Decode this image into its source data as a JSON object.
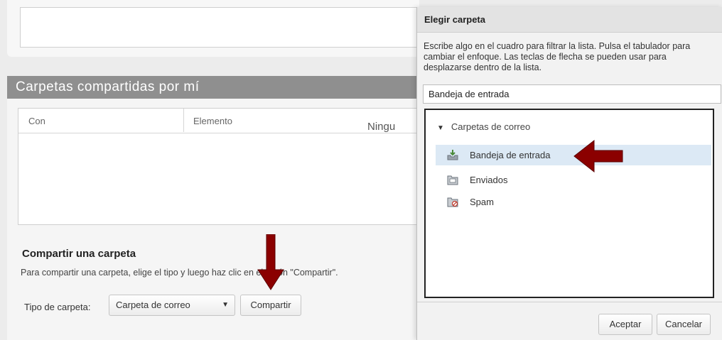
{
  "top_field": {
    "value": ""
  },
  "shared_by_me": {
    "header": "Carpetas compartidas por mí",
    "columns": [
      "Con",
      "Elemento"
    ],
    "empty_text": "Ningu"
  },
  "share_folder": {
    "title": "Compartir una carpeta",
    "description": "Para compartir una carpeta, elige el tipo y luego haz clic en el botón \"Compartir\".",
    "type_label": "Tipo de carpeta:",
    "type_selected": "Carpeta de correo",
    "share_button": "Compartir"
  },
  "dialog": {
    "title": "Elegir carpeta",
    "help": "Escribe algo en el cuadro para filtrar la lista. Pulsa el tabulador para cambiar el enfoque. Las teclas de flecha se pueden usar para desplazarse dentro de la lista.",
    "filter_value": "Bandeja de entrada",
    "tree": {
      "root_label": "Carpetas de correo",
      "items": [
        {
          "label": "Bandeja de entrada",
          "icon": "inbox-icon",
          "selected": true
        },
        {
          "label": "Enviados",
          "icon": "sent-folder-icon",
          "selected": false
        },
        {
          "label": "Spam",
          "icon": "spam-folder-icon",
          "selected": false
        }
      ]
    },
    "accept_button": "Aceptar",
    "cancel_button": "Cancelar"
  },
  "colors": {
    "section_header_bg": "#8f8f8f",
    "selected_row_bg": "#dce9f5",
    "annotation_arrow": "#8b0000"
  }
}
